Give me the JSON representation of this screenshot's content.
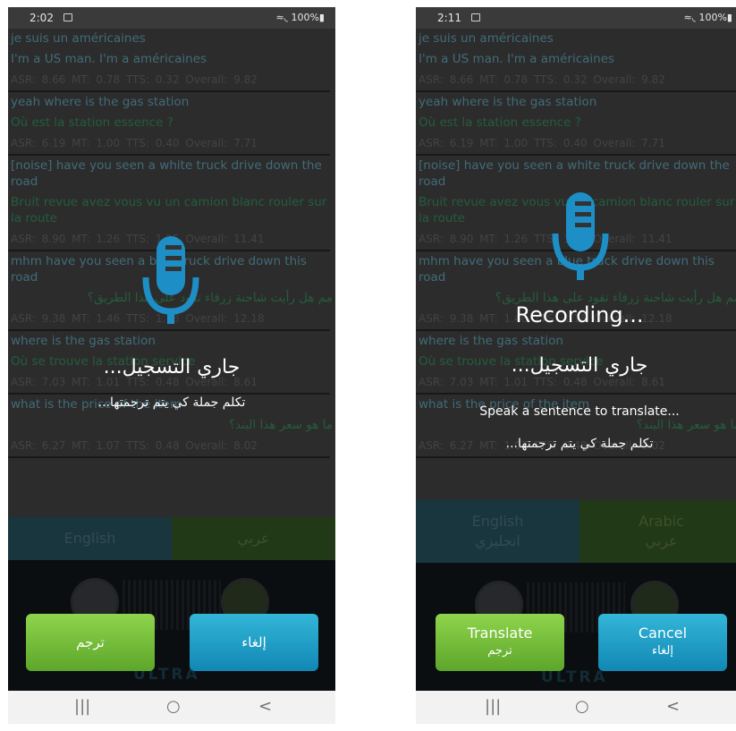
{
  "screens": [
    {
      "status": {
        "time": "2:02",
        "signal": "≈◟ 100%▮"
      },
      "history": [
        {
          "source": "je suis un américaines",
          "target": null,
          "scores": null
        },
        {
          "source": "I'm a US man. I'm a américaines",
          "target": null,
          "scores": "ASR: 8.66   MT: 0.78   TTS: 0.32   Overall: 9.82"
        },
        {
          "source": "yeah where is the gas station",
          "target": "Où est la station essence ?",
          "scores": "ASR: 6.19   MT: 1.00   TTS: 0.40   Overall: 7.71"
        },
        {
          "source": "[noise] have you seen a white truck drive down the road",
          "target": "Bruit revue avez vous vu un camion blanc rouler sur la route",
          "scores": "ASR: 8.90   MT: 1.26   TTS: 1.25   Overall: 11.41"
        },
        {
          "source": "mhm have you seen a blue truck drive down this road",
          "target": "مم هل رأيت شاحنة زرقاء تقود على هذا الطريق؟",
          "target_rtl": true,
          "scores": "ASR: 9.38   MT: 1.46   TTS: 1.18   Overall: 12.18"
        },
        {
          "source": "where is the gas station",
          "target": "Où se trouve la station service",
          "scores": "ASR: 7.03   MT: 1.01   TTS: 0.48   Overall: 8.61"
        },
        {
          "source": "what is the price of the item",
          "target": "ما هو سعر هذا البند؟",
          "target_rtl": true,
          "scores": "ASR: 6.27   MT: 1.07   TTS: 0.48   Overall: 8.02"
        }
      ],
      "languages": {
        "left": [
          "English"
        ],
        "right": [
          "عربي"
        ]
      },
      "footer_logo": "ULTRA",
      "overlay": {
        "recording_en": "",
        "recording_ar": "جاري التسجيل...",
        "prompt_en": "",
        "prompt_ar": "تكلم جملة كي يتم ترجمتها..."
      },
      "buttons": {
        "translate": {
          "en": "",
          "ar": "ترجم"
        },
        "cancel": {
          "en": "",
          "ar": "إلغاء"
        }
      },
      "nav": {
        "recent": "|||",
        "home": "○",
        "back": "<"
      }
    },
    {
      "status": {
        "time": "2:11",
        "signal": "≈◟ 100%▮"
      },
      "history": [
        {
          "source": "je suis un américaines",
          "target": null,
          "scores": null
        },
        {
          "source": "I'm a US man. I'm a américaines",
          "target": null,
          "scores": "ASR: 8.66   MT: 0.78   TTS: 0.32   Overall: 9.82"
        },
        {
          "source": "yeah where is the gas station",
          "target": "Où est la station essence ?",
          "scores": "ASR: 6.19   MT: 1.00   TTS: 0.40   Overall: 7.71"
        },
        {
          "source": "[noise] have you seen a white truck drive down the road",
          "target": "Bruit revue avez vous vu un camion blanc rouler sur la route",
          "scores": "ASR: 8.90   MT: 1.26   TTS: 1.25   Overall: 11.41"
        },
        {
          "source": "mhm have you seen a blue truck drive down this road",
          "target": "مم هل رأيت شاحنة زرقاء تقود على هذا الطريق؟",
          "target_rtl": true,
          "scores": "ASR: 9.38   MT: 1.46   TTS: 1.18   Overall: 12.18"
        },
        {
          "source": "where is the gas station",
          "target": "Où se trouve la station service",
          "scores": "ASR: 7.03   MT: 1.01   TTS: 0.48   Overall: 8.61"
        },
        {
          "source": "what is the price of the item",
          "target": "ما هو سعر هذا البند؟",
          "target_rtl": true,
          "scores": "ASR: 6.27   MT: 1.07   TTS: 0.48   Overall: 8.02"
        }
      ],
      "languages": {
        "left": [
          "English",
          "انجليزي"
        ],
        "right": [
          "Arabic",
          "عربي"
        ]
      },
      "footer_logo": "ULTRA",
      "overlay": {
        "recording_en": "Recording...",
        "recording_ar": "جاري التسجيل...",
        "prompt_en": "Speak a sentence to translate...",
        "prompt_ar": "تكلم جملة كي يتم ترجمتها..."
      },
      "buttons": {
        "translate": {
          "en": "Translate",
          "ar": "ترجم"
        },
        "cancel": {
          "en": "Cancel",
          "ar": "إلغاء"
        }
      },
      "nav": {
        "recent": "|||",
        "home": "○",
        "back": "<"
      }
    }
  ],
  "colors": {
    "translate_button": "#6fbf36",
    "cancel_button": "#1a9fc8",
    "mic": "#1d8fc6",
    "english_bar": "#1d3d47",
    "arabic_bar": "#26411a"
  },
  "icons": [
    "microphone-icon",
    "us-globe-icon",
    "africa-globe-icon",
    "image-notification-icon",
    "wifi-icon",
    "signal-icon",
    "battery-icon",
    "recent-apps-icon",
    "home-icon",
    "back-icon"
  ]
}
